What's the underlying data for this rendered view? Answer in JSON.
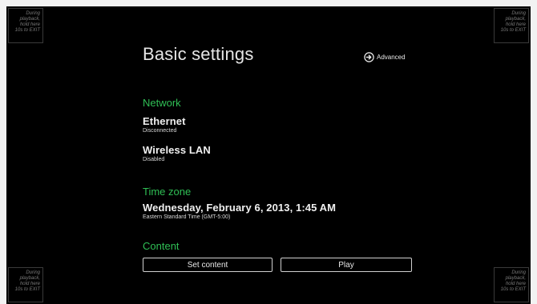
{
  "corner_hint": "During\nplayback,\nhold here\n10s to EXIT",
  "page": {
    "title": "Basic settings",
    "advanced_label": "Advanced"
  },
  "network": {
    "heading": "Network",
    "ethernet_label": "Ethernet",
    "ethernet_status": "Disconnected",
    "wlan_label": "Wireless LAN",
    "wlan_status": "Disabled"
  },
  "timezone": {
    "heading": "Time zone",
    "datetime": "Wednesday, February 6, 2013, 1:45 AM",
    "zone": "Eastern Standard Time (GMT-5:00)"
  },
  "content": {
    "heading": "Content",
    "set_content_label": "Set content",
    "play_label": "Play"
  },
  "colors": {
    "background": "#000000",
    "section_heading": "#2fbf55",
    "text": "#f0f0f0"
  },
  "icons": {
    "advanced": "arrow-right-circle-icon"
  }
}
